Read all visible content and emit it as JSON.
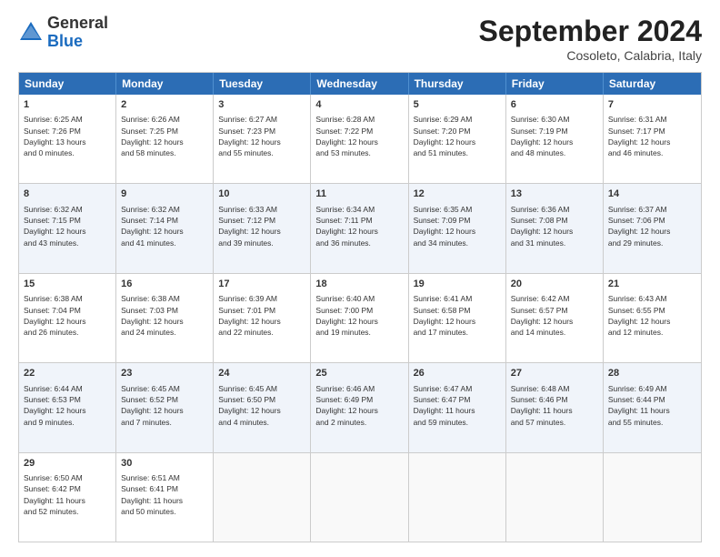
{
  "header": {
    "logo": {
      "general": "General",
      "blue": "Blue"
    },
    "title": "September 2024",
    "subtitle": "Cosoleto, Calabria, Italy"
  },
  "days": [
    "Sunday",
    "Monday",
    "Tuesday",
    "Wednesday",
    "Thursday",
    "Friday",
    "Saturday"
  ],
  "rows": [
    [
      {
        "day": "",
        "info": ""
      },
      {
        "day": "2",
        "info": "Sunrise: 6:26 AM\nSunset: 7:25 PM\nDaylight: 12 hours\nand 58 minutes."
      },
      {
        "day": "3",
        "info": "Sunrise: 6:27 AM\nSunset: 7:23 PM\nDaylight: 12 hours\nand 55 minutes."
      },
      {
        "day": "4",
        "info": "Sunrise: 6:28 AM\nSunset: 7:22 PM\nDaylight: 12 hours\nand 53 minutes."
      },
      {
        "day": "5",
        "info": "Sunrise: 6:29 AM\nSunset: 7:20 PM\nDaylight: 12 hours\nand 51 minutes."
      },
      {
        "day": "6",
        "info": "Sunrise: 6:30 AM\nSunset: 7:19 PM\nDaylight: 12 hours\nand 48 minutes."
      },
      {
        "day": "7",
        "info": "Sunrise: 6:31 AM\nSunset: 7:17 PM\nDaylight: 12 hours\nand 46 minutes."
      }
    ],
    [
      {
        "day": "1",
        "info": "Sunrise: 6:25 AM\nSunset: 7:26 PM\nDaylight: 13 hours\nand 0 minutes."
      },
      {
        "day": "",
        "info": ""
      },
      {
        "day": "",
        "info": ""
      },
      {
        "day": "",
        "info": ""
      },
      {
        "day": "",
        "info": ""
      },
      {
        "day": "",
        "info": ""
      },
      {
        "day": "",
        "info": ""
      }
    ],
    [
      {
        "day": "8",
        "info": "Sunrise: 6:32 AM\nSunset: 7:15 PM\nDaylight: 12 hours\nand 43 minutes."
      },
      {
        "day": "9",
        "info": "Sunrise: 6:32 AM\nSunset: 7:14 PM\nDaylight: 12 hours\nand 41 minutes."
      },
      {
        "day": "10",
        "info": "Sunrise: 6:33 AM\nSunset: 7:12 PM\nDaylight: 12 hours\nand 39 minutes."
      },
      {
        "day": "11",
        "info": "Sunrise: 6:34 AM\nSunset: 7:11 PM\nDaylight: 12 hours\nand 36 minutes."
      },
      {
        "day": "12",
        "info": "Sunrise: 6:35 AM\nSunset: 7:09 PM\nDaylight: 12 hours\nand 34 minutes."
      },
      {
        "day": "13",
        "info": "Sunrise: 6:36 AM\nSunset: 7:08 PM\nDaylight: 12 hours\nand 31 minutes."
      },
      {
        "day": "14",
        "info": "Sunrise: 6:37 AM\nSunset: 7:06 PM\nDaylight: 12 hours\nand 29 minutes."
      }
    ],
    [
      {
        "day": "15",
        "info": "Sunrise: 6:38 AM\nSunset: 7:04 PM\nDaylight: 12 hours\nand 26 minutes."
      },
      {
        "day": "16",
        "info": "Sunrise: 6:38 AM\nSunset: 7:03 PM\nDaylight: 12 hours\nand 24 minutes."
      },
      {
        "day": "17",
        "info": "Sunrise: 6:39 AM\nSunset: 7:01 PM\nDaylight: 12 hours\nand 22 minutes."
      },
      {
        "day": "18",
        "info": "Sunrise: 6:40 AM\nSunset: 7:00 PM\nDaylight: 12 hours\nand 19 minutes."
      },
      {
        "day": "19",
        "info": "Sunrise: 6:41 AM\nSunset: 6:58 PM\nDaylight: 12 hours\nand 17 minutes."
      },
      {
        "day": "20",
        "info": "Sunrise: 6:42 AM\nSunset: 6:57 PM\nDaylight: 12 hours\nand 14 minutes."
      },
      {
        "day": "21",
        "info": "Sunrise: 6:43 AM\nSunset: 6:55 PM\nDaylight: 12 hours\nand 12 minutes."
      }
    ],
    [
      {
        "day": "22",
        "info": "Sunrise: 6:44 AM\nSunset: 6:53 PM\nDaylight: 12 hours\nand 9 minutes."
      },
      {
        "day": "23",
        "info": "Sunrise: 6:45 AM\nSunset: 6:52 PM\nDaylight: 12 hours\nand 7 minutes."
      },
      {
        "day": "24",
        "info": "Sunrise: 6:45 AM\nSunset: 6:50 PM\nDaylight: 12 hours\nand 4 minutes."
      },
      {
        "day": "25",
        "info": "Sunrise: 6:46 AM\nSunset: 6:49 PM\nDaylight: 12 hours\nand 2 minutes."
      },
      {
        "day": "26",
        "info": "Sunrise: 6:47 AM\nSunset: 6:47 PM\nDaylight: 11 hours\nand 59 minutes."
      },
      {
        "day": "27",
        "info": "Sunrise: 6:48 AM\nSunset: 6:46 PM\nDaylight: 11 hours\nand 57 minutes."
      },
      {
        "day": "28",
        "info": "Sunrise: 6:49 AM\nSunset: 6:44 PM\nDaylight: 11 hours\nand 55 minutes."
      }
    ],
    [
      {
        "day": "29",
        "info": "Sunrise: 6:50 AM\nSunset: 6:42 PM\nDaylight: 11 hours\nand 52 minutes."
      },
      {
        "day": "30",
        "info": "Sunrise: 6:51 AM\nSunset: 6:41 PM\nDaylight: 11 hours\nand 50 minutes."
      },
      {
        "day": "",
        "info": ""
      },
      {
        "day": "",
        "info": ""
      },
      {
        "day": "",
        "info": ""
      },
      {
        "day": "",
        "info": ""
      },
      {
        "day": "",
        "info": ""
      }
    ]
  ]
}
